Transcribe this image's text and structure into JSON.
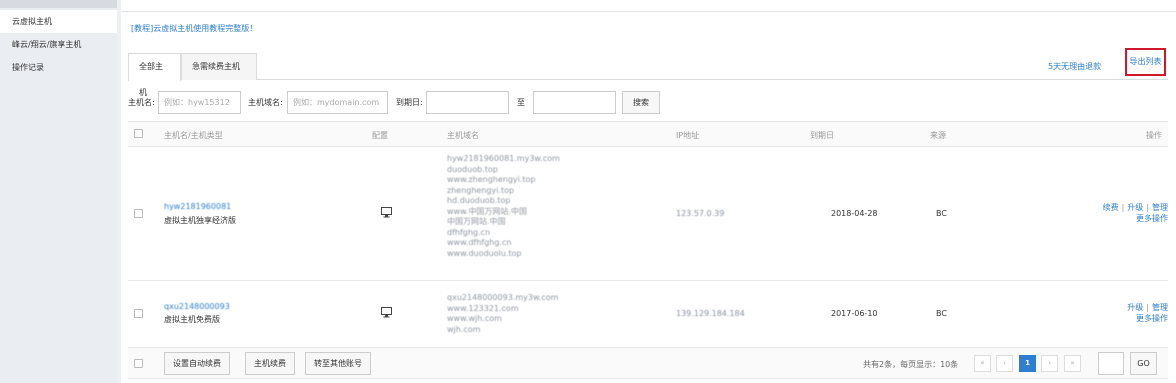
{
  "sidebar": {
    "items": [
      {
        "label": "云虚拟主机"
      },
      {
        "label": "峰云/翔云/旗享主机"
      },
      {
        "label": "操作记录"
      }
    ]
  },
  "notice": "[教程]云虚拟主机使用教程完整版！",
  "tabs": [
    {
      "label": "全部主机"
    },
    {
      "label": "急需续费主机"
    }
  ],
  "links": {
    "refund": "5天无理由退款",
    "export": "导出列表"
  },
  "filter": {
    "host_label": "主机名:",
    "host_placeholder": "例如：hyw15312",
    "domain_label": "主机域名:",
    "domain_placeholder": "例如：mydomain.com",
    "expire_label": "到期日:",
    "to_label": "至",
    "search_button": "搜索"
  },
  "table": {
    "headers": [
      "主机名/主机类型",
      "配置",
      "主机域名",
      "IP地址",
      "到期日",
      "来源",
      "操作"
    ],
    "rows": [
      {
        "host": "hyw2181960081",
        "type": "虚拟主机独享经济版",
        "domains": [
          "hyw2181960081.my3w.com",
          "duoduob.top",
          "www.zhenghengyi.top",
          "zhenghengyi.top",
          "hd.duoduob.top",
          "www.中国万网站.中国",
          "中国万网站.中国",
          "dfhfghg.cn",
          "www.dfhfghg.cn",
          "www.duoduolu.top"
        ],
        "ip": "123.57.0.39",
        "expire": "2018-04-28",
        "source": "BC",
        "ops": [
          "续费",
          "升级",
          "管理"
        ],
        "more": "更多操作"
      },
      {
        "host": "qxu2148000093",
        "type": "虚拟主机免费版",
        "domains": [
          "qxu2148000093.my3w.com",
          "www.123321.com",
          "www.wjh.com",
          "wjh.com"
        ],
        "ip": "139.129.184.184",
        "expire": "2017-06-10",
        "source": "BC",
        "ops": [
          "升级",
          "管理"
        ],
        "more": "更多操作"
      }
    ]
  },
  "footer": {
    "auto_renew": "设置自动续费",
    "renew": "主机续费",
    "transfer": "转至其他账号",
    "summary": "共有2条，每页显示：10条",
    "pager": [
      "«",
      "‹",
      "1",
      "›",
      "»"
    ],
    "go": "GO"
  }
}
